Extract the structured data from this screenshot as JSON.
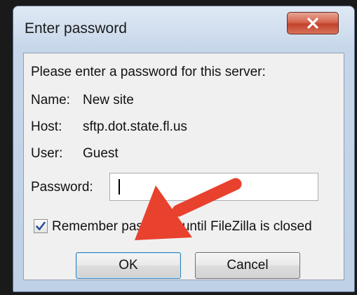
{
  "dialog": {
    "title": "Enter password",
    "prompt": "Please enter a password for this server:",
    "name_label": "Name:",
    "name_value": "New site",
    "host_label": "Host:",
    "host_value": "sftp.dot.state.fl.us",
    "user_label": "User:",
    "user_value": "Guest",
    "password_label": "Password:",
    "password_value": "",
    "remember_label": "Remember password until FileZilla is closed",
    "remember_checked": true,
    "ok_label": "OK",
    "cancel_label": "Cancel"
  },
  "icons": {
    "close": "close-icon",
    "check": "checkmark-icon",
    "annotation": "red-arrow-annotation"
  },
  "colors": {
    "close_button": "#c7462f",
    "arrow": "#e8412e",
    "check": "#2a4f9c"
  }
}
